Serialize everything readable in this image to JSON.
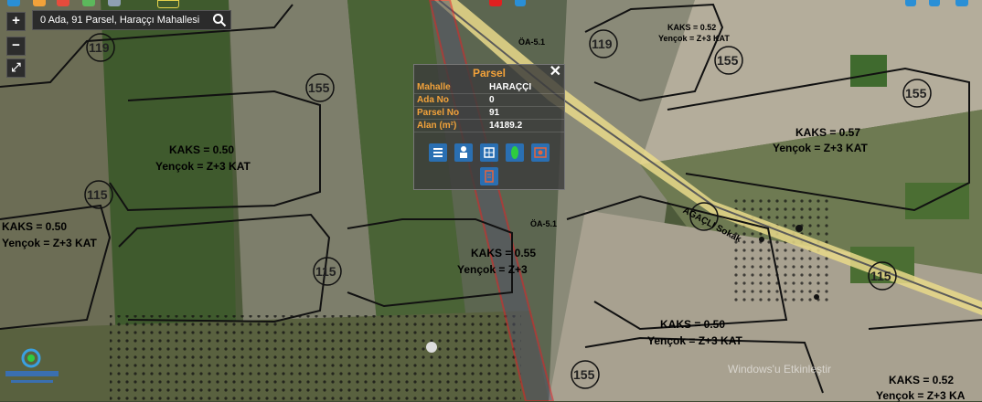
{
  "search": {
    "value": "0 Ada, 91 Parsel, Haraççı Mahallesi"
  },
  "zoom": {
    "in_label": "+",
    "out_label": "−",
    "fullscreen_label": "⤢"
  },
  "popup": {
    "title": "Parsel",
    "close_label": "✕",
    "rows": [
      {
        "label": "Mahalle",
        "value": "HARAÇÇI"
      },
      {
        "label": "Ada No",
        "value": "0"
      },
      {
        "label": "Parsel No",
        "value": "91"
      },
      {
        "label": "Alan (m²)",
        "value": "14189.2"
      }
    ],
    "tools": [
      "list-icon",
      "person-icon",
      "building-icon",
      "leaf-icon",
      "photo-icon",
      "document-icon"
    ]
  },
  "map_labels": {
    "kaks_050": "KAKS = 0.50",
    "kaks_055": "KAKS = 0.55",
    "kaks_057": "KAKS = 0.57",
    "kaks_052": "KAKS = 0.52",
    "yencok_3kat": "Yençok = Z+3 KAT",
    "yencok_short": "Yençok = Z+3",
    "yencok_cut": "Yençok = Z+3 KA",
    "parcel_115": "115",
    "parcel_119": "119",
    "parcel_155": "155",
    "oa": "ÖA-5.1",
    "road": "AĞAÇLI Sokak",
    "watermark": "Windows'u Etkinleştir"
  },
  "colors": {
    "accent": "#f2a23a",
    "parcel_outline": "#e0202a",
    "road": "#e9d98a"
  }
}
